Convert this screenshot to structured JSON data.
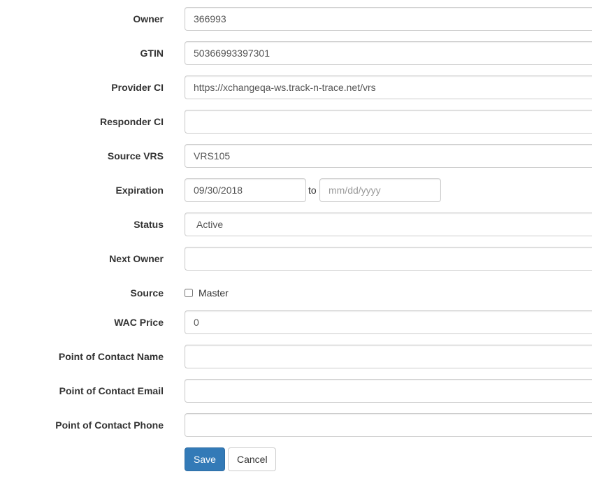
{
  "form": {
    "owner": {
      "label": "Owner",
      "value": "366993"
    },
    "gtin": {
      "label": "GTIN",
      "value": "50366993397301"
    },
    "provider_ci": {
      "label": "Provider CI",
      "value": "https://xchangeqa-ws.track-n-trace.net/vrs"
    },
    "responder_ci": {
      "label": "Responder CI",
      "value": ""
    },
    "source_vrs": {
      "label": "Source VRS",
      "value": "VRS105"
    },
    "expiration": {
      "label": "Expiration",
      "from_value": "09/30/2018",
      "to_text": "to",
      "to_placeholder": "mm/dd/yyyy"
    },
    "status": {
      "label": "Status",
      "selected": "Active"
    },
    "next_owner": {
      "label": "Next Owner",
      "value": ""
    },
    "source": {
      "label": "Source",
      "checkbox_label": "Master",
      "checked": false
    },
    "wac_price": {
      "label": "WAC Price",
      "value": "0"
    },
    "poc_name": {
      "label": "Point of Contact Name",
      "value": ""
    },
    "poc_email": {
      "label": "Point of Contact Email",
      "value": ""
    },
    "poc_phone": {
      "label": "Point of Contact Phone",
      "value": ""
    }
  },
  "actions": {
    "save_label": "Save",
    "cancel_label": "Cancel"
  },
  "colors": {
    "primary": "#337ab7",
    "border": "#cccccc",
    "label_text": "#333333",
    "input_text": "#555555"
  }
}
